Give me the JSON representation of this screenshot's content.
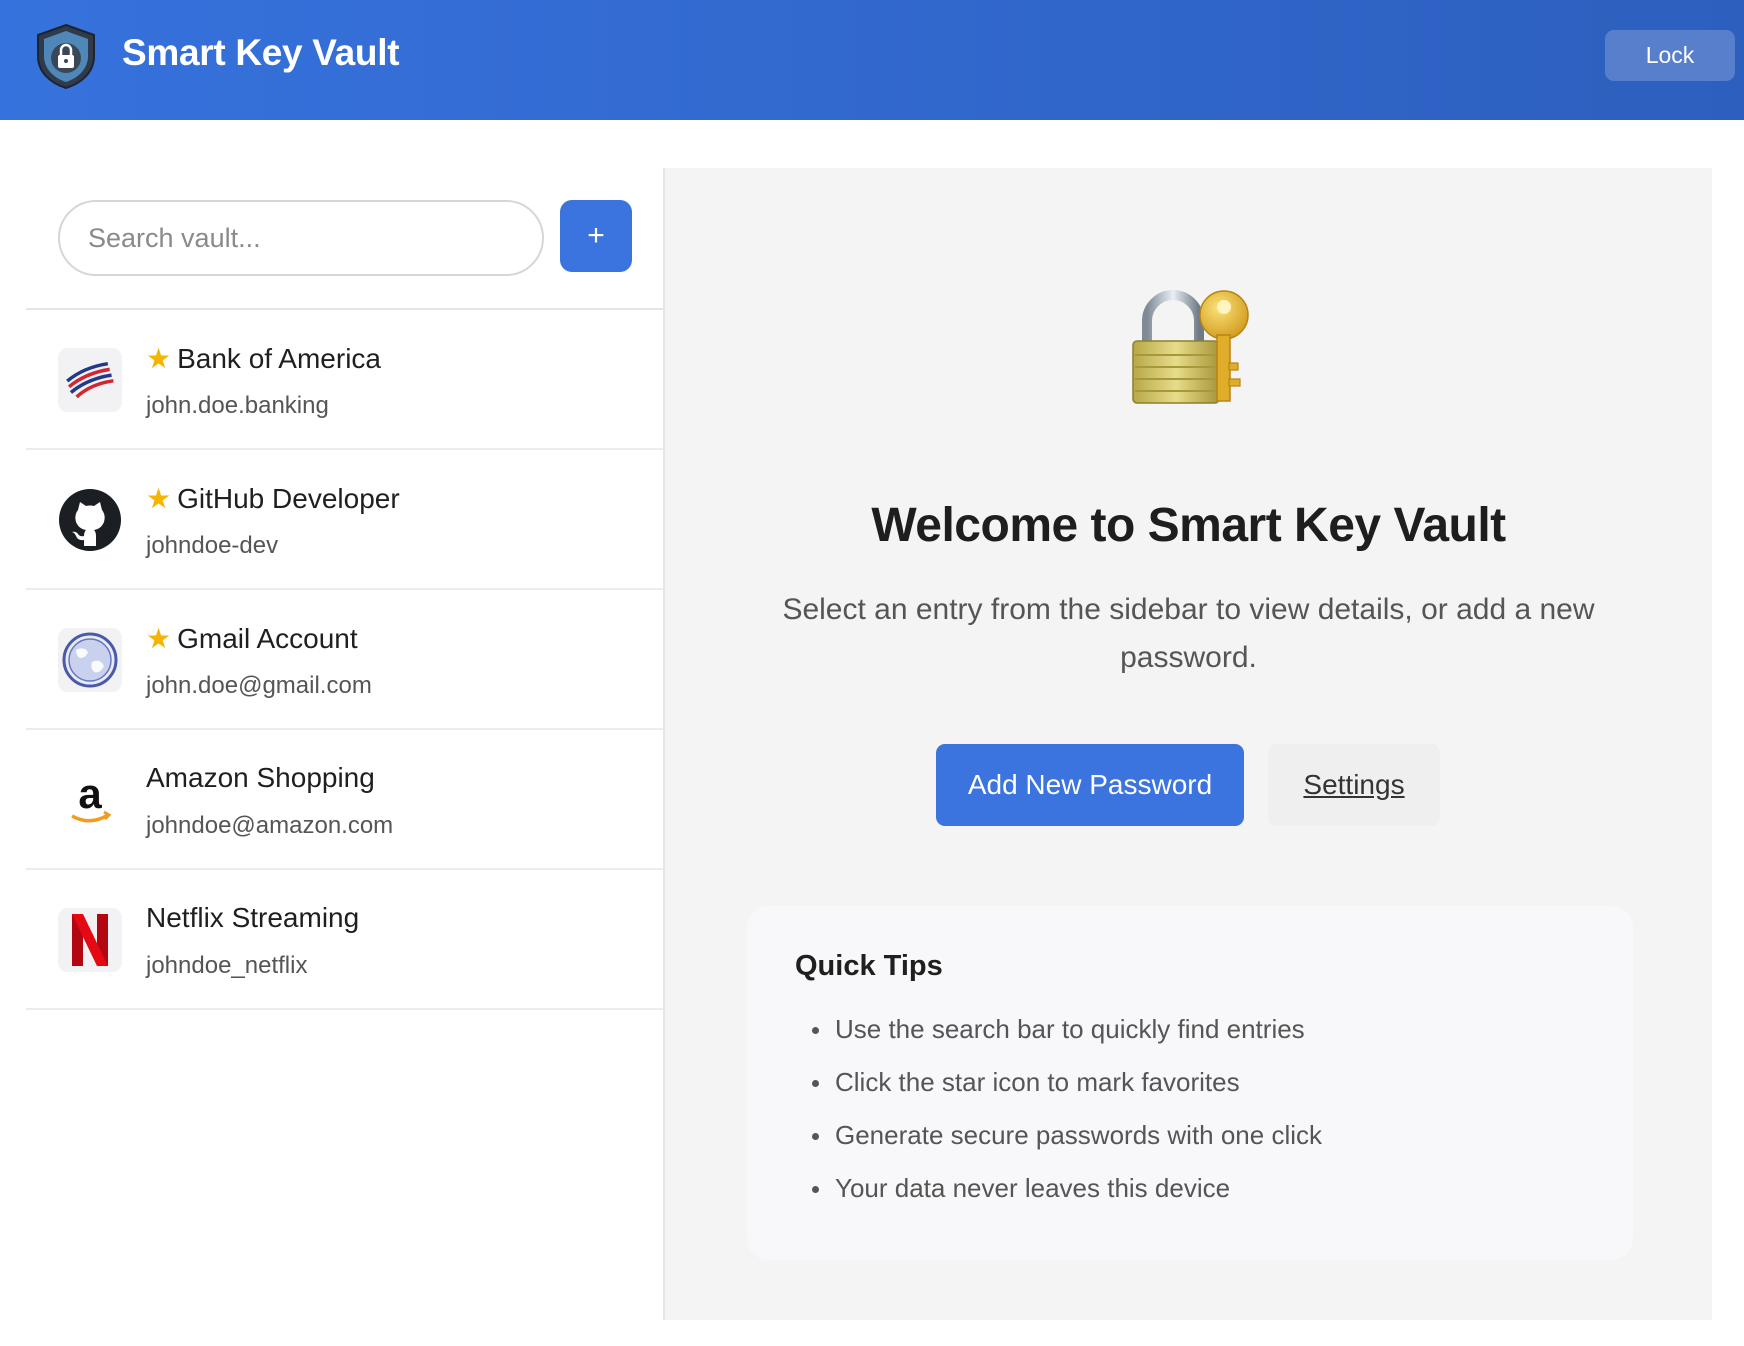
{
  "header": {
    "title": "Smart Key Vault",
    "lock_label": "Lock",
    "logo_icon": "shield-lock-icon"
  },
  "sidebar": {
    "search_placeholder": "Search vault...",
    "add_label": "+",
    "entries": [
      {
        "name": "Bank of America",
        "username": "john.doe.banking",
        "favorite": true,
        "icon": "bank-of-america-logo-icon"
      },
      {
        "name": "GitHub Developer",
        "username": "johndoe-dev",
        "favorite": true,
        "icon": "github-logo-icon"
      },
      {
        "name": "Gmail Account",
        "username": "john.doe@gmail.com",
        "favorite": true,
        "icon": "globe-icon"
      },
      {
        "name": "Amazon Shopping",
        "username": "johndoe@amazon.com",
        "favorite": false,
        "icon": "amazon-logo-icon"
      },
      {
        "name": "Netflix Streaming",
        "username": "johndoe_netflix",
        "favorite": false,
        "icon": "netflix-logo-icon"
      }
    ],
    "star_glyph": "★"
  },
  "main": {
    "hero_icon": "lock-with-key-icon",
    "title": "Welcome to Smart Key Vault",
    "subtitle": "Select an entry from the sidebar to view details, or add a new password.",
    "primary_button": "Add New Password",
    "secondary_button": "Settings",
    "tips": {
      "title": "Quick Tips",
      "items": [
        "Use the search bar to quickly find entries",
        "Click the star icon to mark favorites",
        "Generate secure passwords with one click",
        "Your data never leaves this device"
      ]
    }
  },
  "colors": {
    "header_start": "#3672dd",
    "header_end": "#2d5fbe",
    "accent": "#3b74de",
    "star": "#f4b400"
  }
}
